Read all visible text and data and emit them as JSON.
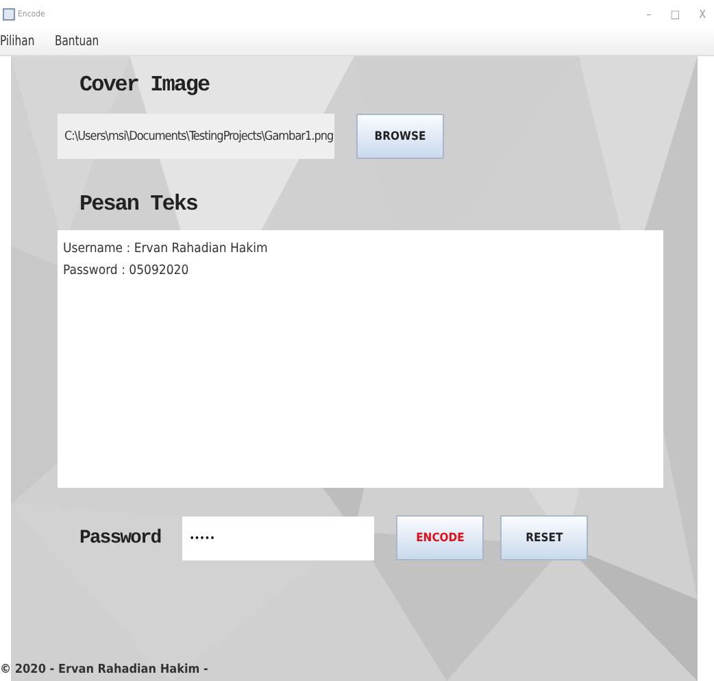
{
  "window": {
    "title": "Encode",
    "controls": [
      "–",
      "□",
      "X"
    ]
  },
  "menu": [
    "Pilihan",
    "Bantuan"
  ],
  "cover": {
    "label": "Cover Image",
    "path": "C:\\Users\\msi\\Documents\\TestingProjects\\Gambar1.png",
    "button": "BROWSE"
  },
  "message": {
    "label": "Pesan Teks",
    "lines": [
      "Username : Ervan Rahadian Hakim",
      "Password : 05092020"
    ]
  },
  "password": {
    "label": "Password",
    "value": "•••••"
  },
  "buttons": [
    {
      "label": "ENCODE",
      "color": "#e0101a"
    },
    {
      "label": "RESET",
      "color": "#222222"
    }
  ],
  "footer": "© 2020 - Ervan Rahadian Hakim -"
}
